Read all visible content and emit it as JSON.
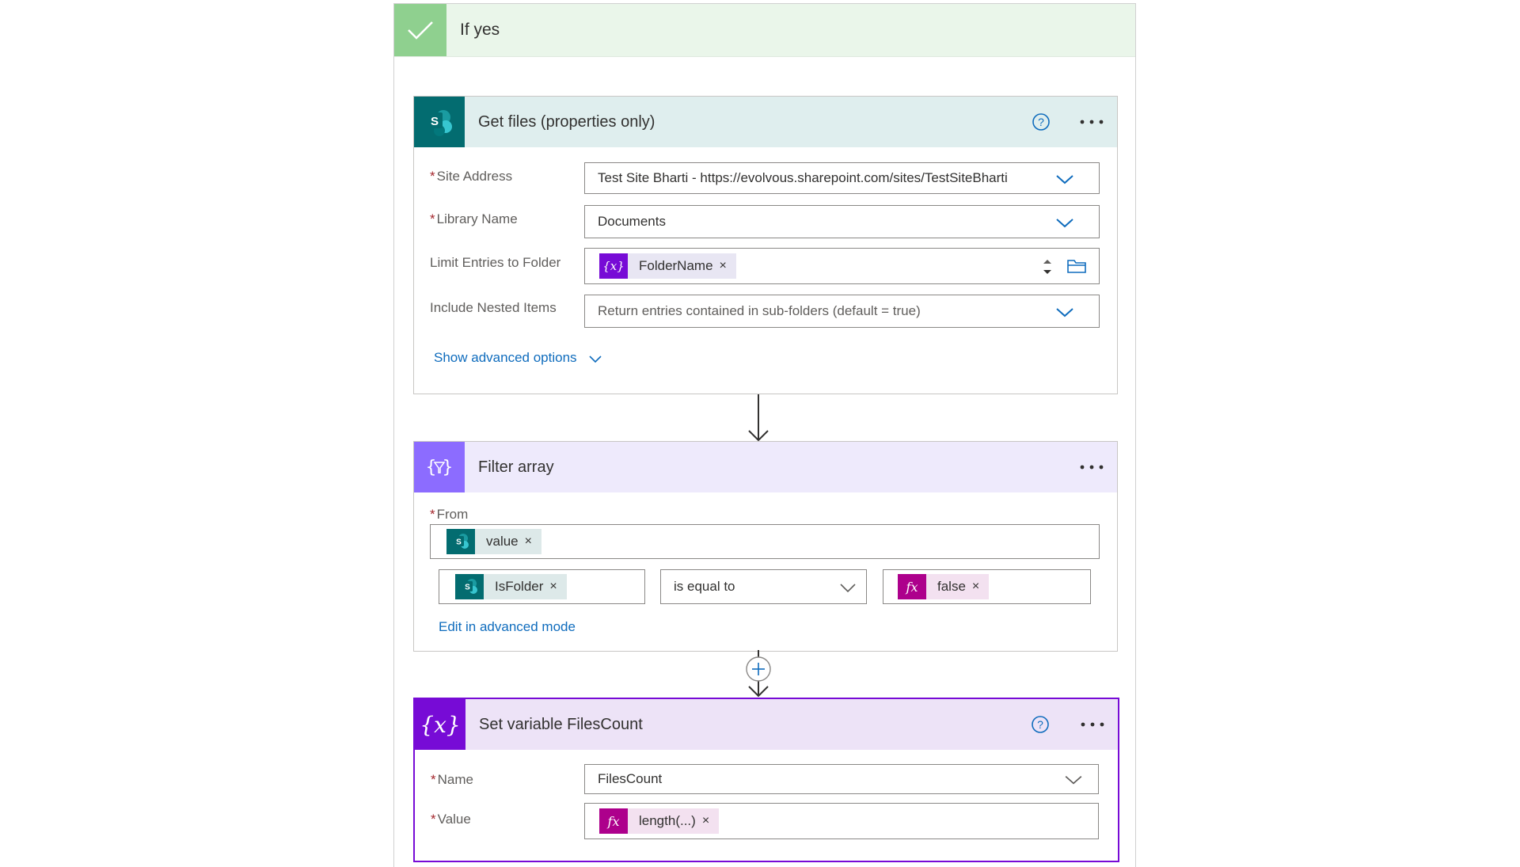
{
  "branch": {
    "title": "If yes"
  },
  "get_files": {
    "title": "Get files (properties only)",
    "fields": {
      "site_address": {
        "label": "Site Address",
        "value": "Test Site Bharti - https://evolvous.sharepoint.com/sites/TestSiteBharti"
      },
      "library_name": {
        "label": "Library Name",
        "value": "Documents"
      },
      "limit_folder": {
        "label": "Limit Entries to Folder",
        "token": "FolderName"
      },
      "nested_items": {
        "label": "Include Nested Items",
        "value": "Return entries contained in sub-folders (default = true)"
      }
    },
    "show_advanced": "Show advanced options"
  },
  "filter_array": {
    "title": "Filter array",
    "from_label": "From",
    "from_token": "value",
    "condition": {
      "left_token": "IsFolder",
      "operator": "is equal to",
      "right_token": "false"
    },
    "edit_advanced": "Edit in advanced mode"
  },
  "set_variable": {
    "title": "Set variable FilesCount",
    "fields": {
      "name": {
        "label": "Name",
        "value": "FilesCount"
      },
      "value": {
        "label": "Value",
        "token": "length(...)"
      }
    }
  },
  "required_marker": "*",
  "token_close": "×",
  "colors": {
    "sharepoint": "#036c70",
    "variable": "#770bd6",
    "filter": "#8c6cff",
    "expression": "#ad008c",
    "branch_green": "#8fd08f",
    "link": "#0f6cbd"
  },
  "icons": [
    "check-icon",
    "sharepoint-icon",
    "help-icon",
    "more-icon",
    "chevron-down-icon",
    "variable-icon",
    "folder-icon",
    "filter-icon",
    "fx-icon",
    "plus-icon",
    "arrow-down-icon"
  ]
}
